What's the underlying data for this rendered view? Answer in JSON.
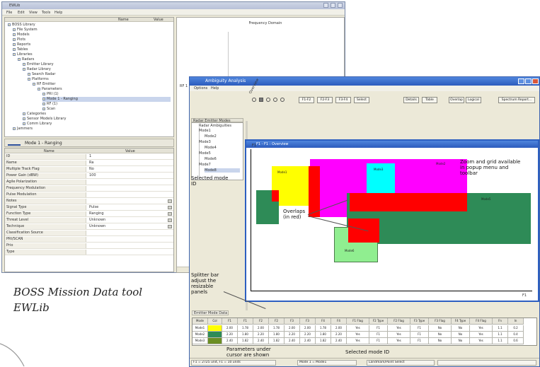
{
  "back_window": {
    "title": "EWLib",
    "menu": [
      "File",
      "Edit",
      "View",
      "Tools",
      "Help"
    ],
    "tree_headers": [
      "Name",
      "Value"
    ],
    "tree_rows": [
      {
        "label": "BOSS Library",
        "indent": 0,
        "selected": false
      },
      {
        "label": "File System",
        "indent": 1,
        "selected": false
      },
      {
        "label": "Models",
        "indent": 1,
        "selected": false
      },
      {
        "label": "Plots",
        "indent": 1,
        "selected": false
      },
      {
        "label": "Reports",
        "indent": 1,
        "selected": false
      },
      {
        "label": "Tables",
        "indent": 1,
        "selected": false
      },
      {
        "label": "Libraries",
        "indent": 1,
        "selected": false
      },
      {
        "label": "Radars",
        "indent": 2,
        "selected": false
      },
      {
        "label": "Emitter Library",
        "indent": 3,
        "selected": false
      },
      {
        "label": "Radar Library",
        "indent": 3,
        "selected": false
      },
      {
        "label": "Search Radar",
        "indent": 4,
        "selected": false
      },
      {
        "label": "Platforms",
        "indent": 4,
        "selected": false
      },
      {
        "label": "RF Emitter",
        "indent": 5,
        "selected": false
      },
      {
        "label": "Parameters",
        "indent": 6,
        "selected": false
      },
      {
        "label": "PRI (1)",
        "indent": 7,
        "selected": false
      },
      {
        "label": "Mode 1 - Ranging",
        "indent": 7,
        "selected": true
      },
      {
        "label": "RF (1)",
        "indent": 7,
        "selected": false
      },
      {
        "label": "Scan",
        "indent": 7,
        "selected": false
      },
      {
        "label": "Categories",
        "indent": 3,
        "selected": false
      },
      {
        "label": "Sensor Models Library",
        "indent": 3,
        "selected": false
      },
      {
        "label": "Comm Library",
        "indent": 3,
        "selected": false
      },
      {
        "label": "Jammers",
        "indent": 1,
        "selected": false
      }
    ],
    "props_title": "Mode 1 - Ranging",
    "props_headers": [
      "Name",
      "Value"
    ],
    "props_rows": [
      {
        "name": "ID",
        "value": "1",
        "dropdown": false
      },
      {
        "name": "Name",
        "value": "Ra",
        "dropdown": false
      },
      {
        "name": "Multiple Track Flag",
        "value": "No",
        "dropdown": false
      },
      {
        "name": "Power Gain (dBW)",
        "value": "100",
        "dropdown": false
      },
      {
        "name": "Agile Polarization",
        "value": "",
        "dropdown": false
      },
      {
        "name": "Frequency Modulation",
        "value": "",
        "dropdown": false
      },
      {
        "name": "Pulse Modulation",
        "value": "",
        "dropdown": false
      },
      {
        "name": "Notes",
        "value": "",
        "dropdown": true
      },
      {
        "name": "Signal Type",
        "value": "Pulse",
        "dropdown": true
      },
      {
        "name": "Function Type",
        "value": "Ranging",
        "dropdown": true
      },
      {
        "name": "Threat Level",
        "value": "Unknown",
        "dropdown": true
      },
      {
        "name": "Technique",
        "value": "Unknown",
        "dropdown": true
      },
      {
        "name": "Classification Source",
        "value": "",
        "dropdown": false
      },
      {
        "name": "PRI/SCAN",
        "value": "",
        "dropdown": false
      },
      {
        "name": "Prio",
        "value": "",
        "dropdown": false
      },
      {
        "name": "Type",
        "value": "",
        "dropdown": false
      }
    ],
    "plot_title": "Frequency Domain",
    "plot_series_label": "RF 1 Mode 1 - Ranging"
  },
  "front_window": {
    "title": "Ambiguity Analysis",
    "menu": [
      "Options",
      "Help"
    ],
    "left_tabs": "Radar Emitter Modes",
    "left_subtitle": "Radar Ambiguities",
    "rotated_label": "Overview",
    "toolbar_buttons": [
      "F1-F2",
      "F2-F3",
      "F3-F4",
      "Select",
      "Details",
      "Table",
      "Overlap",
      "Logical",
      "Spectrum Report..."
    ],
    "tree_items": [
      {
        "label": "Mode1",
        "selected": false
      },
      {
        "label": "Mode2",
        "selected": false
      },
      {
        "label": "Mode3",
        "selected": false
      },
      {
        "label": "Mode4",
        "selected": false
      },
      {
        "label": "Mode5",
        "selected": false
      },
      {
        "label": "Mode6",
        "selected": false
      },
      {
        "label": "Mode7",
        "selected": false
      },
      {
        "label": "Mode8",
        "selected": true
      }
    ],
    "overview_title": "F1 - F1 : Overview",
    "axis_labels": {
      "y": "F1",
      "x": "F1"
    },
    "regions": [
      {
        "name": "Mode1",
        "color": "#ffff00"
      },
      {
        "name": "Mode2",
        "color": "#ff00ff"
      },
      {
        "name": "Mode3",
        "color": "#00ffff"
      },
      {
        "name": "Mode4",
        "color": "#2e8b57"
      },
      {
        "name": "Mode5",
        "color": "#2e8b57"
      },
      {
        "name": "Overlap",
        "color": "#ff0000"
      },
      {
        "name": "Mode6",
        "color": "#90ee90"
      }
    ],
    "table_tab": "Emitter Mode Data",
    "table_headers": [
      "Mode",
      "Col",
      "F1",
      "F1",
      "F2",
      "F2",
      "F3",
      "F3",
      "F4",
      "F4",
      "F1 Flag",
      "F2 Type",
      "F2 Flag",
      "F3 Type",
      "F3 Flag",
      "F4 Type",
      "F4 Flag",
      "Fn",
      "In"
    ],
    "table_rows": [
      {
        "mode": "Mode1",
        "color": "#ffff00",
        "cells": [
          "2.00",
          "1.78",
          "2.00",
          "1.78",
          "2.00",
          "2.00",
          "1.78",
          "2.00",
          "Yes",
          "F1",
          "Yes",
          "F1",
          "No",
          "No",
          "Yes",
          "1.1",
          "0.2"
        ]
      },
      {
        "mode": "Mode2",
        "color": "#2e8b57",
        "cells": [
          "2.20",
          "1.80",
          "2.20",
          "1.80",
          "2.20",
          "2.20",
          "1.80",
          "2.20",
          "Yes",
          "F1",
          "Yes",
          "F1",
          "No",
          "No",
          "Yes",
          "1.1",
          "0.4"
        ]
      },
      {
        "mode": "Mode3",
        "color": "#6b8e23",
        "cells": [
          "2.40",
          "1.82",
          "2.40",
          "1.82",
          "2.40",
          "2.40",
          "1.82",
          "2.40",
          "Yes",
          "F1",
          "Yes",
          "F1",
          "No",
          "No",
          "Yes",
          "1.1",
          "0.6"
        ]
      }
    ],
    "status": [
      "F1 = 2725 unit, F1 = 10 units",
      "Mode 1 = Mode1",
      "Landmark/Point Select"
    ]
  },
  "annotations": {
    "zoom_grid": "Zoom and grid available\nin popup menu and\ntoolbar",
    "overlaps": "Overlaps\n(in red)",
    "selected_mode": "Selected mode\nID",
    "splitter": "Splitter bar\nadjust the\nresizable\npanels",
    "params_under": "Parameters under\ncursor are shown",
    "selected_mode_bottom": "Selected mode ID"
  },
  "caption": "BOSS Mission Data tool\nEWLib"
}
